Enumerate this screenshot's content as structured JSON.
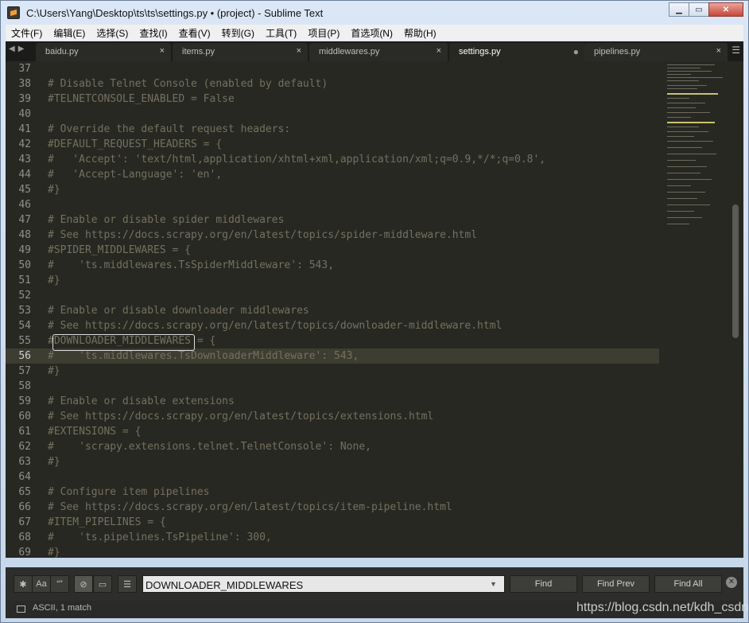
{
  "window": {
    "title": "C:\\Users\\Yang\\Desktop\\ts\\ts\\settings.py • (project) - Sublime Text"
  },
  "menu": [
    "文件(F)",
    "编辑(E)",
    "选择(S)",
    "查找(I)",
    "查看(V)",
    "转到(G)",
    "工具(T)",
    "项目(P)",
    "首选项(N)",
    "帮助(H)"
  ],
  "tabs": [
    {
      "label": "baidu.py",
      "active": false,
      "dirty": false
    },
    {
      "label": "items.py",
      "active": false,
      "dirty": false
    },
    {
      "label": "middlewares.py",
      "active": false,
      "dirty": false
    },
    {
      "label": "settings.py",
      "active": true,
      "dirty": true
    },
    {
      "label": "pipelines.py",
      "active": false,
      "dirty": false
    }
  ],
  "tab_close_glyph": "×",
  "tab_dirty_glyph": "●",
  "editor": {
    "current_line": "56",
    "lines": [
      {
        "n": "37",
        "text": ""
      },
      {
        "n": "38",
        "text": "# Disable Telnet Console (enabled by default)"
      },
      {
        "n": "39",
        "text": "#TELNETCONSOLE_ENABLED = False"
      },
      {
        "n": "40",
        "text": ""
      },
      {
        "n": "41",
        "text": "# Override the default request headers:"
      },
      {
        "n": "42",
        "text": "#DEFAULT_REQUEST_HEADERS = {"
      },
      {
        "n": "43",
        "text": "#   'Accept': 'text/html,application/xhtml+xml,application/xml;q=0.9,*/*;q=0.8',"
      },
      {
        "n": "44",
        "text": "#   'Accept-Language': 'en',"
      },
      {
        "n": "45",
        "text": "#}"
      },
      {
        "n": "46",
        "text": ""
      },
      {
        "n": "47",
        "text": "# Enable or disable spider middlewares"
      },
      {
        "n": "48",
        "text": "# See https://docs.scrapy.org/en/latest/topics/spider-middleware.html"
      },
      {
        "n": "49",
        "text": "#SPIDER_MIDDLEWARES = {"
      },
      {
        "n": "50",
        "text": "#    'ts.middlewares.TsSpiderMiddleware': 543,"
      },
      {
        "n": "51",
        "text": "#}"
      },
      {
        "n": "52",
        "text": ""
      },
      {
        "n": "53",
        "text": "# Enable or disable downloader middlewares"
      },
      {
        "n": "54",
        "text": "# See https://docs.scrapy.org/en/latest/topics/downloader-middleware.html"
      },
      {
        "n": "55",
        "text": "#DOWNLOADER_MIDDLEWARES = {"
      },
      {
        "n": "56",
        "text": "#    'ts.middlewares.TsDownloaderMiddleware': 543,"
      },
      {
        "n": "57",
        "text": "#}"
      },
      {
        "n": "58",
        "text": ""
      },
      {
        "n": "59",
        "text": "# Enable or disable extensions"
      },
      {
        "n": "60",
        "text": "# See https://docs.scrapy.org/en/latest/topics/extensions.html"
      },
      {
        "n": "61",
        "text": "#EXTENSIONS = {"
      },
      {
        "n": "62",
        "text": "#    'scrapy.extensions.telnet.TelnetConsole': None,"
      },
      {
        "n": "63",
        "text": "#}"
      },
      {
        "n": "64",
        "text": ""
      },
      {
        "n": "65",
        "text": "# Configure item pipelines"
      },
      {
        "n": "66",
        "text": "# See https://docs.scrapy.org/en/latest/topics/item-pipeline.html"
      },
      {
        "n": "67",
        "text": "#ITEM_PIPELINES = {"
      },
      {
        "n": "68",
        "text": "#    'ts.pipelines.TsPipeline': 300,"
      },
      {
        "n": "69",
        "text": "#}"
      }
    ]
  },
  "find": {
    "options": [
      {
        "name": "regex-toggle",
        "glyph": "✱",
        "on": false
      },
      {
        "name": "case-toggle",
        "glyph": "Aa",
        "on": false
      },
      {
        "name": "whole-word-toggle",
        "glyph": "“”",
        "on": false
      },
      {
        "name": "wrap-toggle",
        "glyph": "⊘",
        "on": true
      },
      {
        "name": "in-selection-toggle",
        "glyph": "▭",
        "on": false
      },
      {
        "name": "highlight-toggle",
        "glyph": "☰",
        "on": false
      }
    ],
    "query": "DOWNLOADER_MIDDLEWARES",
    "dropdown_glyph": "▼",
    "find_label": "Find",
    "find_prev_label": "Find Prev",
    "find_all_label": "Find All",
    "close_glyph": "✕"
  },
  "status": {
    "text": "ASCII, 1 match",
    "watermark": "https://blog.csdn.net/kdh_csdn"
  },
  "colors": {
    "editor_bg": "#272822",
    "comment": "#75715e",
    "gutter": "#8f908a",
    "current_line_bg": "#3e3d32"
  }
}
